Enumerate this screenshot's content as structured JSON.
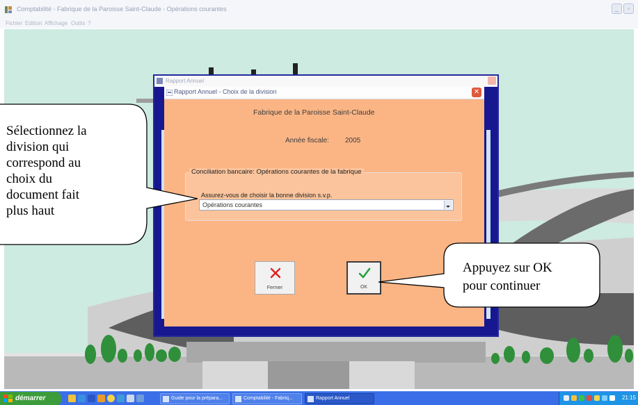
{
  "app": {
    "title": "Comptabilité - Fabrique de la Paroisse Saint-Claude - Opérations courantes",
    "menu": [
      "Fichier",
      "Edition",
      "Affichage",
      "Outils",
      "?"
    ]
  },
  "background_window": {
    "title": "Rapport Annuel"
  },
  "dialog": {
    "title": "Rapport Annuel - Choix de la division",
    "organization": "Fabrique de la Paroisse Saint-Claude",
    "fiscal_year_label": "Année fiscale:",
    "fiscal_year_value": "2005",
    "group_label": "Conciliation bancaire:  Opérations courantes de la fabrique",
    "instruction": "Assurez-vous de choisir la bonne division s.v.p.",
    "division_selected": "Opérations courantes",
    "close_button_label": "Fermer",
    "ok_button_label": "OK"
  },
  "annotations": {
    "left_callout": [
      "Sélectionnez la",
      "division qui",
      "correspond au",
      "choix du",
      "document fait",
      "plus haut"
    ],
    "right_callout": [
      "Appuyez sur OK",
      "pour continuer"
    ]
  },
  "taskbar": {
    "start_label": "démarrer",
    "tasks": [
      "Guide pour la prépara...",
      "Comptabilité - Fabriq...",
      "Rapport Annuel"
    ],
    "clock": "21:15"
  },
  "colors": {
    "desktop_background": "#cdebe1",
    "dialog_background": "#fbb585",
    "outer_window_frame": "#17178f",
    "taskbar": "#3a6ee8",
    "start_button": "#3c9c3c",
    "close_icon": "#e0201e",
    "ok_icon": "#23a13b"
  }
}
